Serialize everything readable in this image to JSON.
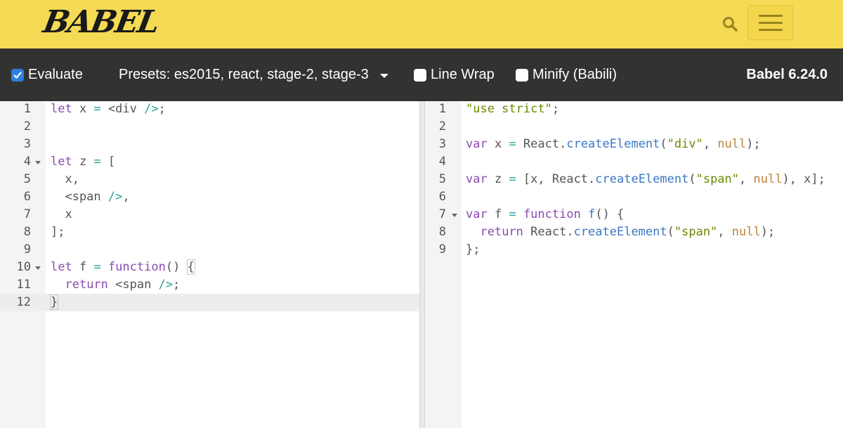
{
  "header": {
    "logo_text": "BABEL",
    "colors": {
      "background": "#f5da55",
      "toolbar": "#323330",
      "checkbox_checked": "#2f80e0"
    }
  },
  "toolbar": {
    "evaluate_label": "Evaluate",
    "evaluate_checked": true,
    "presets_label": "Presets: es2015, react, stage-2, stage-3",
    "line_wrap_label": "Line Wrap",
    "line_wrap_checked": false,
    "minify_label": "Minify (Babili)",
    "minify_checked": false,
    "version_label": "Babel 6.24.0"
  },
  "input_editor": {
    "active_line": 12,
    "lines": [
      {
        "n": "1",
        "fold": false,
        "tokens": [
          [
            "k",
            "let"
          ],
          [
            "p",
            " x "
          ],
          [
            "o",
            "="
          ],
          [
            "p",
            " <div "
          ],
          [
            "o",
            "/>"
          ],
          [
            "p",
            ";"
          ]
        ]
      },
      {
        "n": "2",
        "fold": false,
        "tokens": []
      },
      {
        "n": "3",
        "fold": false,
        "tokens": []
      },
      {
        "n": "4",
        "fold": true,
        "tokens": [
          [
            "k",
            "let"
          ],
          [
            "p",
            " z "
          ],
          [
            "o",
            "="
          ],
          [
            "p",
            " ["
          ]
        ]
      },
      {
        "n": "5",
        "fold": false,
        "tokens": [
          [
            "p",
            "  x,"
          ]
        ]
      },
      {
        "n": "6",
        "fold": false,
        "tokens": [
          [
            "p",
            "  <span "
          ],
          [
            "o",
            "/>"
          ],
          [
            "p",
            ","
          ]
        ]
      },
      {
        "n": "7",
        "fold": false,
        "tokens": [
          [
            "p",
            "  x"
          ]
        ]
      },
      {
        "n": "8",
        "fold": false,
        "tokens": [
          [
            "p",
            "];"
          ]
        ]
      },
      {
        "n": "9",
        "fold": false,
        "tokens": []
      },
      {
        "n": "10",
        "fold": true,
        "tokens": [
          [
            "k",
            "let"
          ],
          [
            "p",
            " f "
          ],
          [
            "o",
            "="
          ],
          [
            "p",
            " "
          ],
          [
            "k",
            "function"
          ],
          [
            "p",
            "() "
          ],
          [
            "bracket",
            "{"
          ]
        ]
      },
      {
        "n": "11",
        "fold": false,
        "tokens": [
          [
            "p",
            "  "
          ],
          [
            "k",
            "return"
          ],
          [
            "p",
            " <span "
          ],
          [
            "o",
            "/>"
          ],
          [
            "p",
            ";"
          ]
        ]
      },
      {
        "n": "12",
        "fold": false,
        "tokens": [
          [
            "bracket",
            "}"
          ],
          [
            "cursor",
            ""
          ]
        ]
      }
    ]
  },
  "output_editor": {
    "lines": [
      {
        "n": "1",
        "fold": false,
        "tokens": [
          [
            "s",
            "\"use strict\""
          ],
          [
            "p",
            ";"
          ]
        ]
      },
      {
        "n": "2",
        "fold": false,
        "tokens": []
      },
      {
        "n": "3",
        "fold": false,
        "tokens": [
          [
            "k",
            "var"
          ],
          [
            "p",
            " x "
          ],
          [
            "o",
            "="
          ],
          [
            "p",
            " React."
          ],
          [
            "f",
            "createElement"
          ],
          [
            "p",
            "("
          ],
          [
            "s",
            "\"div\""
          ],
          [
            "p",
            ", "
          ],
          [
            "n",
            "null"
          ],
          [
            "p",
            ");"
          ]
        ]
      },
      {
        "n": "4",
        "fold": false,
        "tokens": []
      },
      {
        "n": "5",
        "fold": false,
        "tokens": [
          [
            "k",
            "var"
          ],
          [
            "p",
            " z "
          ],
          [
            "o",
            "="
          ],
          [
            "p",
            " [x, React."
          ],
          [
            "f",
            "createElement"
          ],
          [
            "p",
            "("
          ],
          [
            "s",
            "\"span\""
          ],
          [
            "p",
            ", "
          ],
          [
            "n",
            "null"
          ],
          [
            "p",
            "), x];"
          ]
        ]
      },
      {
        "n": "6",
        "fold": false,
        "tokens": []
      },
      {
        "n": "7",
        "fold": true,
        "tokens": [
          [
            "k",
            "var"
          ],
          [
            "p",
            " f "
          ],
          [
            "o",
            "="
          ],
          [
            "p",
            " "
          ],
          [
            "k",
            "function"
          ],
          [
            "p",
            " "
          ],
          [
            "f",
            "f"
          ],
          [
            "p",
            "() {"
          ]
        ]
      },
      {
        "n": "8",
        "fold": false,
        "tokens": [
          [
            "p",
            "  "
          ],
          [
            "k",
            "return"
          ],
          [
            "p",
            " React."
          ],
          [
            "f",
            "createElement"
          ],
          [
            "p",
            "("
          ],
          [
            "s",
            "\"span\""
          ],
          [
            "p",
            ", "
          ],
          [
            "n",
            "null"
          ],
          [
            "p",
            ");"
          ]
        ]
      },
      {
        "n": "9",
        "fold": false,
        "tokens": [
          [
            "p",
            "};"
          ]
        ]
      }
    ]
  }
}
